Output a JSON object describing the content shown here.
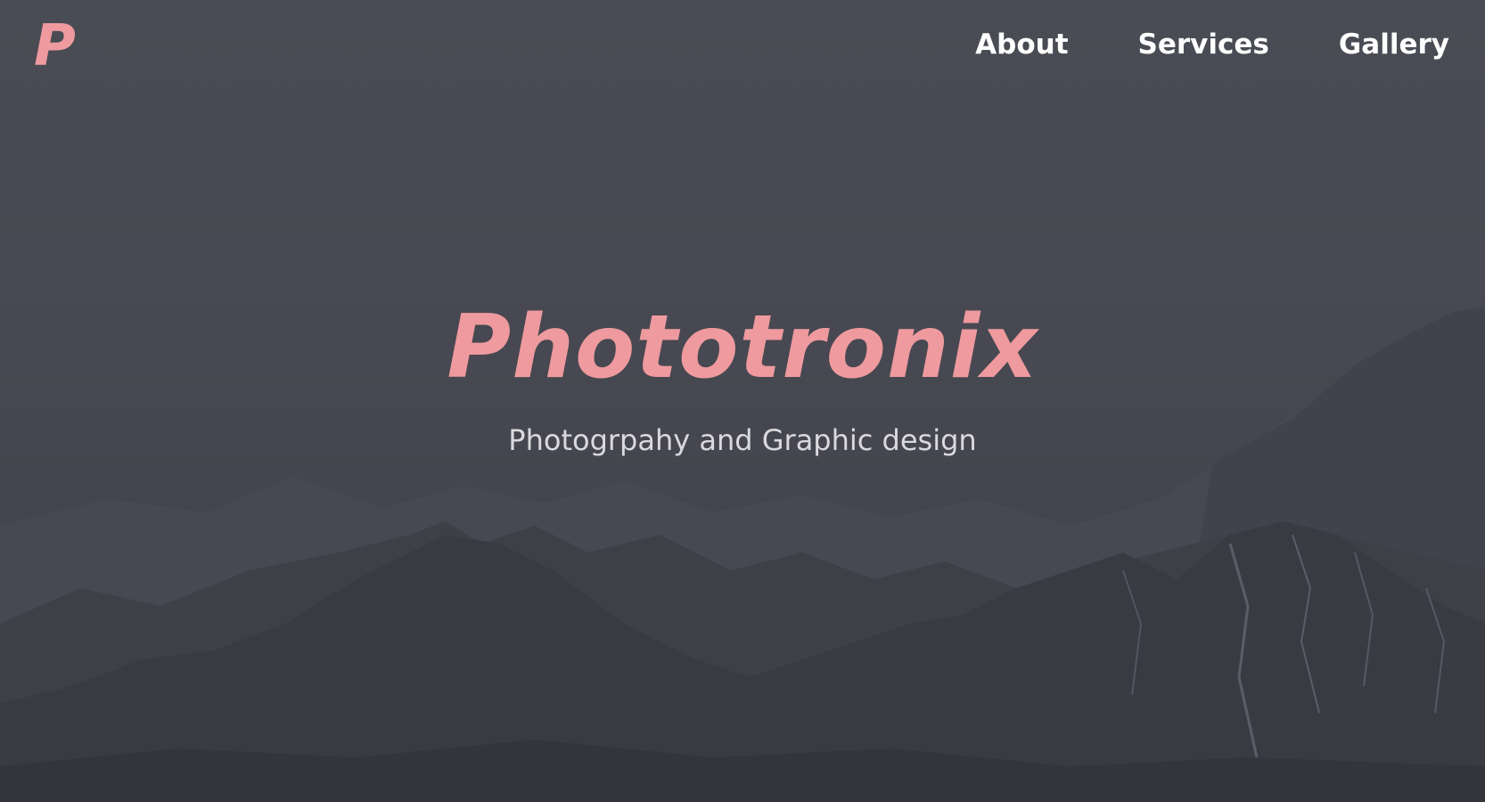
{
  "header": {
    "logo_text": "P",
    "nav": [
      {
        "label": "About"
      },
      {
        "label": "Services"
      },
      {
        "label": "Gallery"
      }
    ]
  },
  "hero": {
    "title": "Phototronix",
    "tagline": "Photogrpahy and Graphic design",
    "background": "mountain-landscape-image"
  },
  "colors": {
    "accent": "#ee9a9e",
    "overlay": "#46474f",
    "nav_text": "#ffffff",
    "tagline_text": "#d9d9de"
  }
}
